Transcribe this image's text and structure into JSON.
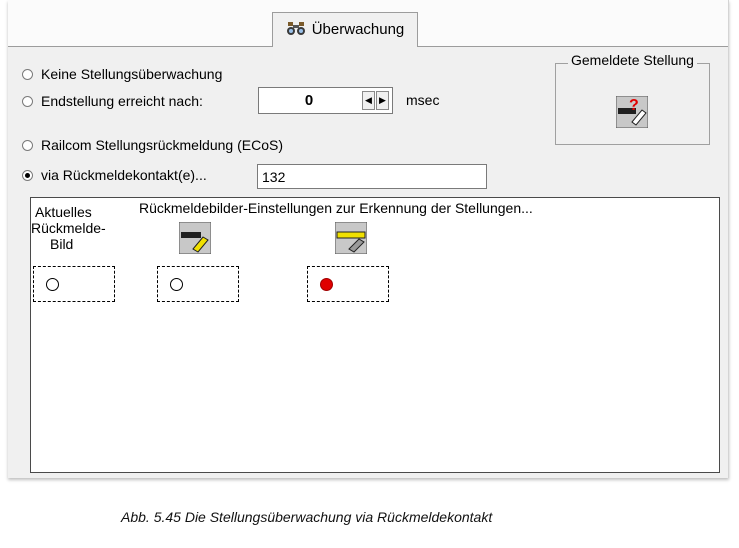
{
  "tab": {
    "label": "Überwachung",
    "icon": "binoculars-icon"
  },
  "options": [
    {
      "label": "Keine Stellungsüberwachung",
      "selected": false
    },
    {
      "label": "Endstellung erreicht nach:",
      "selected": false
    },
    {
      "label": "Railcom Stellungsrückmeldung (ECoS)",
      "selected": false
    },
    {
      "label": "via Rückmeldekontakt(e)...",
      "selected": true
    }
  ],
  "delay": {
    "value": "0",
    "unit": "msec"
  },
  "contact": {
    "value": "132"
  },
  "reported_position": {
    "title": "Gemeldete Stellung",
    "icon": "unknown-turnout-icon"
  },
  "feedback": {
    "current_label_1": "Aktuelles",
    "current_label_2": "Rückmelde-",
    "current_label_3": "Bild",
    "settings_title": "Rückmeldebilder-Einstellungen zur Erkennung der Stellungen...",
    "states": [
      {
        "icon": "turnout-diverging-icon",
        "indicator": "off"
      },
      {
        "icon": "turnout-straight-icon",
        "indicator": "on"
      }
    ],
    "current_indicator": "off"
  },
  "caption": "Abb. 5.45    Die Stellungsüberwachung via Rückmeldekontakt",
  "colors": {
    "panel": "#f0f0f0",
    "indicator_on": "#e00000",
    "turnout_yellow": "#f0e000"
  }
}
